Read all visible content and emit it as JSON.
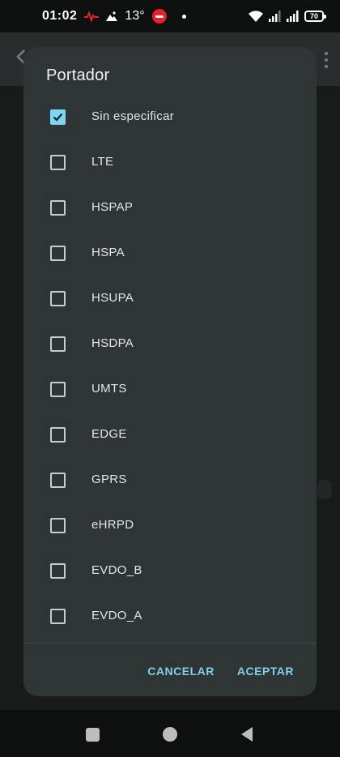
{
  "status_bar": {
    "time": "01:02",
    "temperature": "13°",
    "battery": "70",
    "icons": [
      "pulse-icon",
      "mountain-icon",
      "app-badge-icon",
      "dot-icon",
      "wifi-icon",
      "signal-icon",
      "signal-icon",
      "battery-icon"
    ]
  },
  "dialog": {
    "title": "Portador",
    "options": [
      {
        "label": "Sin especificar",
        "checked": true
      },
      {
        "label": "LTE",
        "checked": false
      },
      {
        "label": "HSPAP",
        "checked": false
      },
      {
        "label": "HSPA",
        "checked": false
      },
      {
        "label": "HSUPA",
        "checked": false
      },
      {
        "label": "HSDPA",
        "checked": false
      },
      {
        "label": "UMTS",
        "checked": false
      },
      {
        "label": "EDGE",
        "checked": false
      },
      {
        "label": "GPRS",
        "checked": false
      },
      {
        "label": "eHRPD",
        "checked": false
      },
      {
        "label": "EVDO_B",
        "checked": false
      },
      {
        "label": "EVDO_A",
        "checked": false
      }
    ],
    "cancel_label": "CANCELAR",
    "accept_label": "ACEPTAR"
  },
  "colors": {
    "accent": "#7fd6f2",
    "dialog_bg": "#2f3434",
    "screen_bg": "#141616"
  },
  "nav_bar": {
    "icons": [
      "recents-square-icon",
      "home-circle-icon",
      "back-triangle-icon"
    ]
  }
}
